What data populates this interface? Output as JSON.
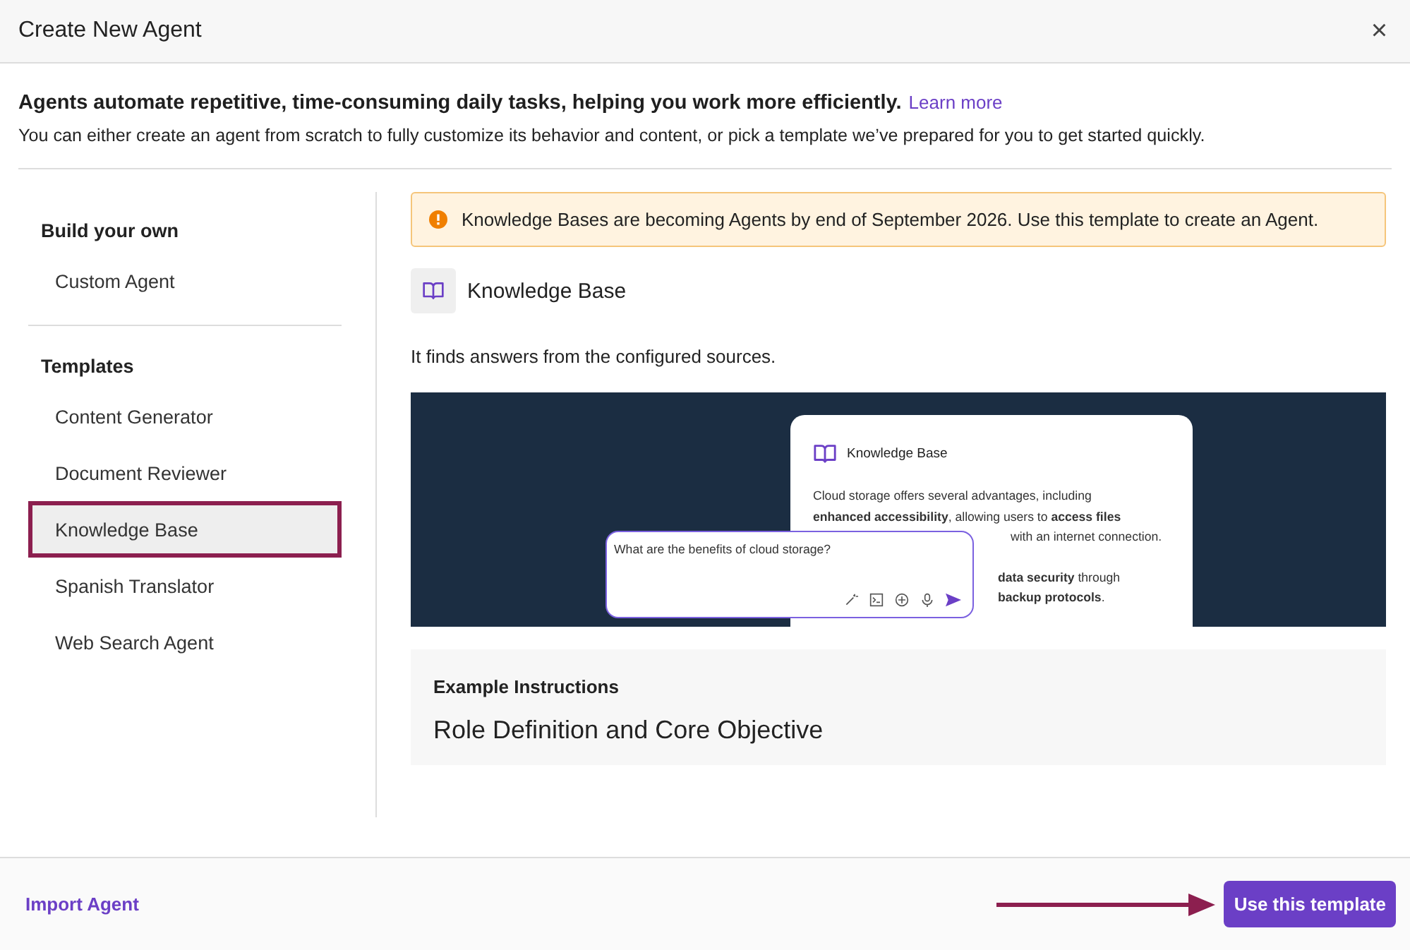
{
  "window": {
    "title": "Create New Agent",
    "close": "×"
  },
  "intro": {
    "headline": "Agents automate repetitive, time-consuming daily tasks, helping you work more efficiently.",
    "link": "Learn more",
    "description": "You can either create an agent from scratch to fully customize its behavior and content, or pick a template we’ve prepared for you to get started quickly."
  },
  "sidebar": {
    "sections": [
      {
        "title": "Build your own",
        "items": [
          {
            "label": "Custom Agent",
            "selected": false
          }
        ]
      },
      {
        "title": "Templates",
        "items": [
          {
            "label": "Content Generator",
            "selected": false
          },
          {
            "label": "Document Reviewer",
            "selected": false
          },
          {
            "label": "Knowledge Base",
            "selected": true
          },
          {
            "label": "Spanish Translator",
            "selected": false
          },
          {
            "label": "Web Search Agent",
            "selected": false
          }
        ]
      }
    ]
  },
  "notice": {
    "text": "Knowledge Bases are becoming Agents by end of September 2026. Use this template to create an Agent."
  },
  "template": {
    "name": "Knowledge Base",
    "description": "It finds answers from the configured sources."
  },
  "preview": {
    "card_title": "Knowledge Base",
    "card_lines": [
      "Cloud storage offers several advantages, including",
      "**enhanced accessibility**, allowing users to **access files**"
    ],
    "card_fragments": [
      "with an internet connection.",
      "**data security** through",
      "**backup protocols**."
    ],
    "question": "What are the benefits of cloud storage?"
  },
  "instructions": {
    "label": "Example Instructions",
    "heading": "Role Definition and Core Objective"
  },
  "footer": {
    "import": "Import Agent",
    "primary": "Use this template"
  }
}
